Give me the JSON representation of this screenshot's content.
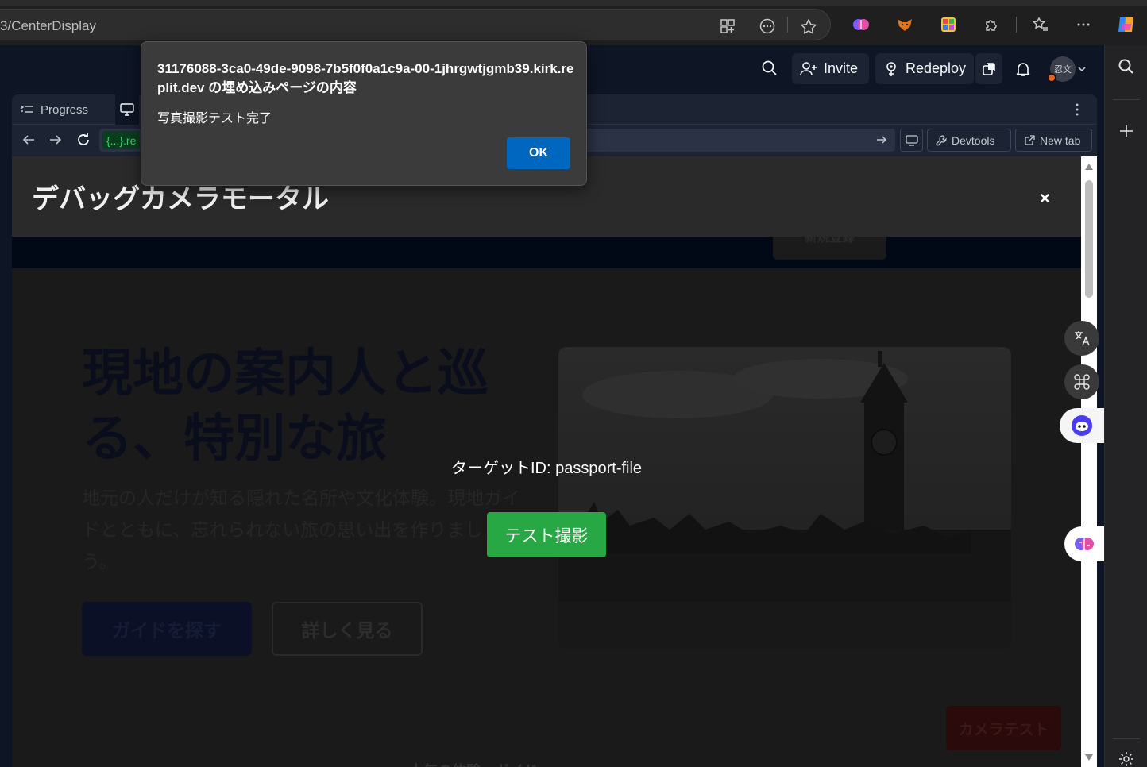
{
  "browser": {
    "address_text": "3/CenterDisplay"
  },
  "replit": {
    "invite_label": "Invite",
    "redeploy_label": "Redeploy",
    "avatar_text": "忍文",
    "tabs": [
      {
        "label": "Progress"
      }
    ],
    "url_badge": "{...}.re",
    "devtools_label": "Devtools",
    "new_tab_label": "New tab"
  },
  "site": {
    "nav_button": "新規登録",
    "hero_title": "現地の案内人と巡る、特別な旅",
    "hero_subtitle": "地元の人だけが知る隠れた名所や文化体験。現地ガイドとともに、忘れられない旅の思い出を作りましょう。",
    "cta_primary": "ガイドを探す",
    "cta_secondary": "詳しく見る",
    "camera_test_button": "カメラテスト",
    "bottom_text": "人気の体験・ガイド"
  },
  "modal": {
    "title": "デバッグカメラモータル",
    "close": "×",
    "target_id": "ターゲットID: passport-file",
    "test_button": "テスト撮影"
  },
  "alert": {
    "origin": "31176088-3ca0-49de-9098-7b5f0f0a1c9a-00-1jhrgwtjgmb39.kirk.replit.dev の埋め込みページの内容",
    "message": "写真撮影テスト完了",
    "ok_label": "OK"
  },
  "colors": {
    "ok_button": "#0067c0",
    "test_button": "#28a745",
    "url_badge": "#3bd16f"
  }
}
